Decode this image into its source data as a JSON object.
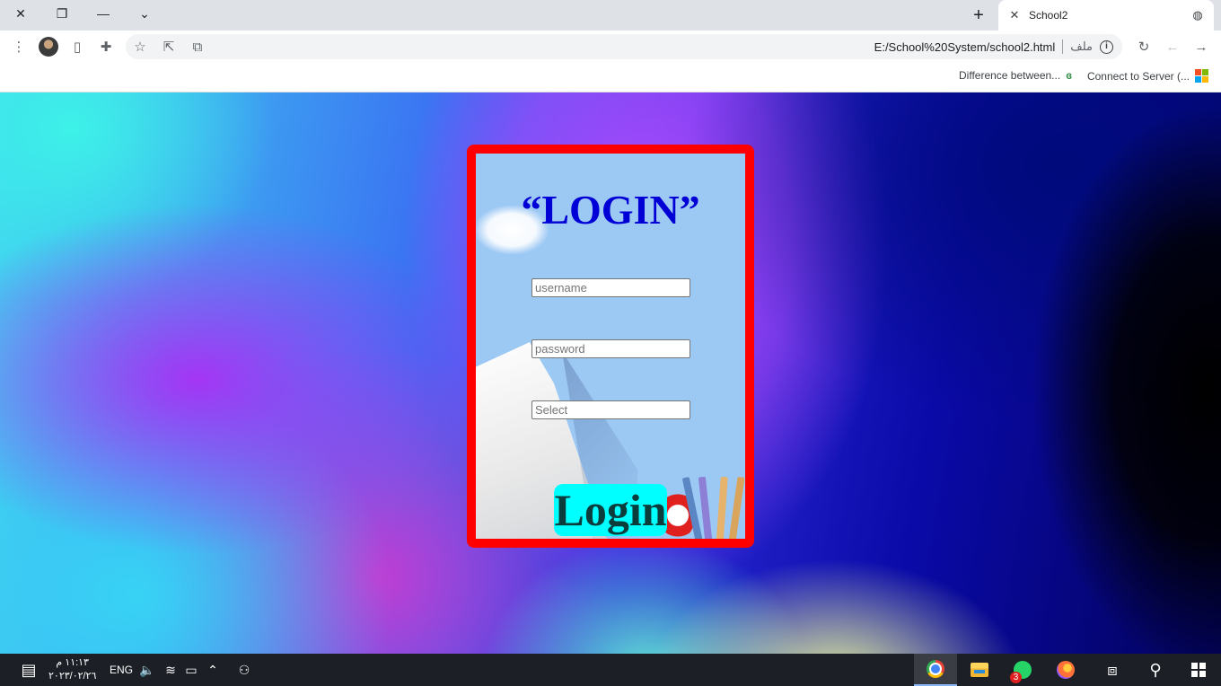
{
  "browser": {
    "tab_title": "School2",
    "tab_close_glyph": "✕",
    "new_tab_glyph": "+",
    "url": "E:/School%20System/school2.html",
    "file_label": "ملف",
    "info_glyph": "i",
    "window_buttons": {
      "close": "✕",
      "restore": "❐",
      "minimize": "—",
      "tab_search": "⌄"
    },
    "toolbar_glyphs": {
      "menu": "⋮",
      "side_panel": "▯",
      "extensions": "✚",
      "bookmark": "☆",
      "share": "⇱",
      "cast": "⧉",
      "reload": "↻",
      "back": "←",
      "forward": "→",
      "globe": "◍"
    },
    "bookmarks": [
      {
        "label": "Difference between...",
        "icon": "gfg-icon",
        "glyph": "ɞ"
      },
      {
        "label": "Connect to Server (...",
        "icon": "microsoft-icon"
      }
    ],
    "microsoft_colors": [
      "#f25022",
      "#7fba00",
      "#00a4ef",
      "#ffb900"
    ]
  },
  "login": {
    "title": "“LOGIN”",
    "username_placeholder": "username",
    "password_placeholder": "password",
    "select_placeholder": "Select",
    "button_label": "Login",
    "colors": {
      "border": "#ff0000",
      "title": "#0000d6",
      "button_bg": "#00ffff",
      "card_bg": "#9cc8f4"
    }
  },
  "taskbar": {
    "time": "١١:١٣ م",
    "date": "٢٠٢٣/٠٢/٢٦",
    "language": "ENG",
    "notification_count": "3",
    "glyphs": {
      "notifications": "▤",
      "volume": "🔈",
      "wifi": "≋",
      "battery": "▭",
      "chevron_up": "⌃",
      "people": "⚇",
      "task_view": "⧈",
      "search": "⚲"
    }
  }
}
